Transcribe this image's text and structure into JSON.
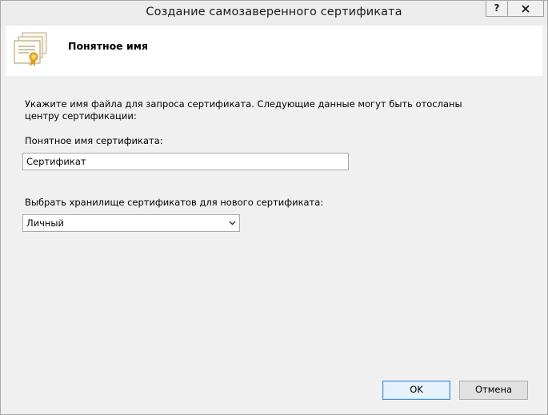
{
  "window": {
    "title": "Создание самозаверенного сертификата",
    "help_label": "?",
    "close_label": "✕"
  },
  "header": {
    "title": "Понятное имя",
    "icon": "certificate-icon"
  },
  "form": {
    "description": "Укажите имя файла для запроса сертификата. Следующие данные могут быть отосланы центру сертификации:",
    "friendly_name_label": "Понятное имя сертификата:",
    "friendly_name_value": "Сертификат",
    "store_label": "Выбрать хранилище сертификатов для нового сертификата:",
    "store_value": "Личный"
  },
  "buttons": {
    "ok_label": "OK",
    "cancel_label": "Отмена"
  },
  "colors": {
    "accent": "#3c8fd4",
    "ribbon": "#e0a020"
  }
}
